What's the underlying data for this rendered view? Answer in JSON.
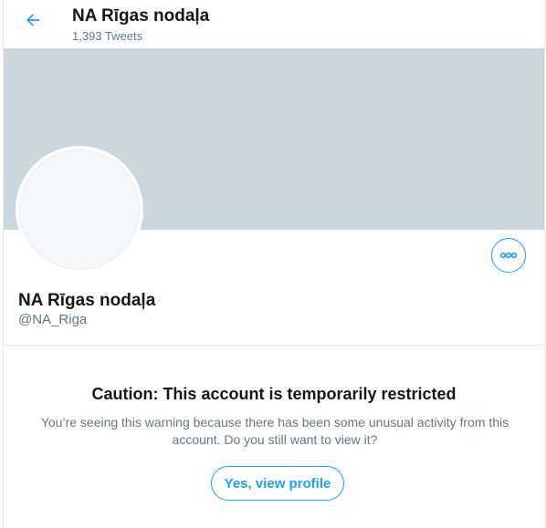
{
  "colors": {
    "accent": "#1da1f2",
    "banner": "#ccd6dd",
    "text_primary": "#14171a",
    "text_secondary": "#657786",
    "border": "#e6ecf0"
  },
  "header": {
    "back_icon": "arrow-left-icon",
    "title": "NA Rīgas nodaļa",
    "tweet_count": "1,393 Tweets"
  },
  "profile": {
    "display_name": "NA Rīgas nodaļa",
    "handle": "@NA_Riga",
    "more_icon": "more-horizontal-icon"
  },
  "warning": {
    "title": "Caution: This account is temporarily restricted",
    "message": "You’re seeing this warning because there has been some unusual activity from this account. Do you still want to view it?",
    "button_label": "Yes, view profile"
  }
}
